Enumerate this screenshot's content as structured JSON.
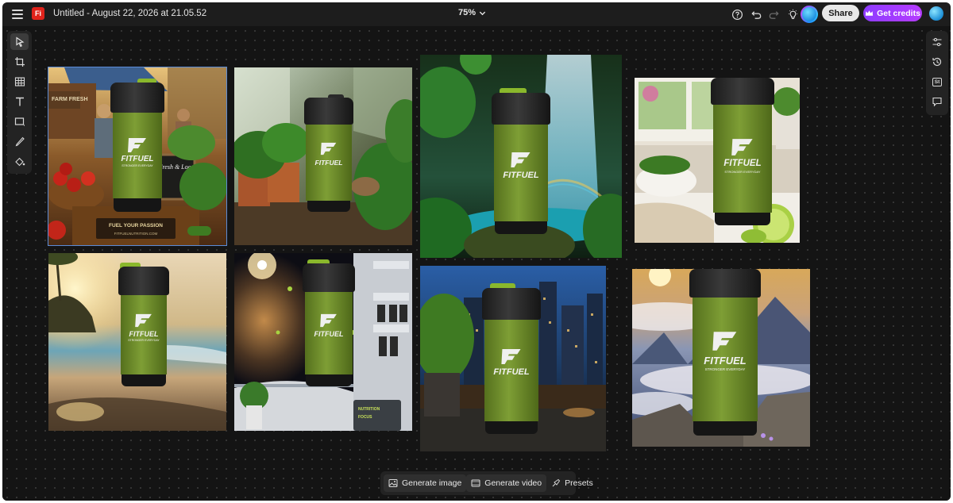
{
  "app": {
    "logo_text": "Fi",
    "document_title": "Untitled - August 22, 2026 at 21.05.52",
    "zoom": "75%",
    "accent_color": "#a23cff",
    "brand_color": "#e0231b"
  },
  "toolbar": {
    "share_label": "Share",
    "credits_label": "Get credits",
    "icons": [
      "help-icon",
      "undo-icon",
      "redo-icon",
      "lightbulb-icon",
      "profile-avatar"
    ]
  },
  "left_tools": [
    "select-tool",
    "crop-tool",
    "grid-tool",
    "text-tool",
    "shape-tool",
    "pen-tool",
    "fill-tool"
  ],
  "right_tools": [
    "adjustments-icon",
    "history-icon",
    "stock-icon",
    "comments-icon"
  ],
  "right_tools_badge": "St",
  "bottom_bar": {
    "generate_image": "Generate image",
    "generate_video": "Generate video",
    "presets": "Presets"
  },
  "canvas_images": [
    {
      "scene": "farmers-market",
      "selected": true,
      "texts": [
        "FARM FRESH",
        "Fresh & Local",
        "FUEL YOUR PASSION",
        "FITFUELNUTRITION.COM"
      ]
    },
    {
      "scene": "greenhouse",
      "selected": false,
      "texts": []
    },
    {
      "scene": "jungle-waterfall",
      "selected": false,
      "texts": []
    },
    {
      "scene": "kitchen-window",
      "selected": false,
      "texts": []
    },
    {
      "scene": "beach-sunset",
      "selected": false,
      "texts": []
    },
    {
      "scene": "space-station",
      "selected": false,
      "texts": [
        "NUTRITION",
        "FOCUS"
      ]
    },
    {
      "scene": "city-night",
      "selected": false,
      "texts": []
    },
    {
      "scene": "mountain-clouds",
      "selected": false,
      "texts": []
    }
  ],
  "product": {
    "brand": "FITFUEL",
    "tagline": "STRONGER EVERYDAY"
  }
}
